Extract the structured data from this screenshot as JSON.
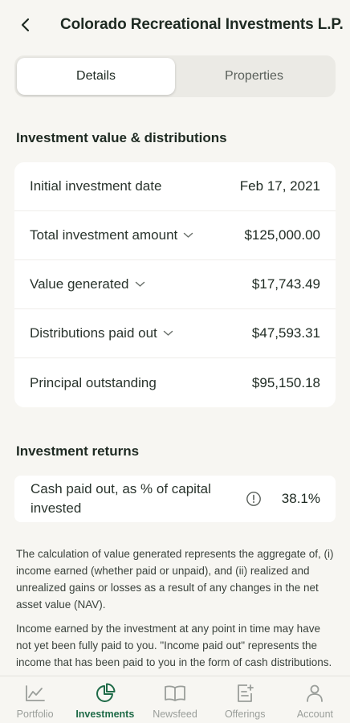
{
  "header": {
    "back_icon": "chevron-left-icon",
    "title": "Colorado Recreational Investments L.P."
  },
  "tabs": [
    {
      "label": "Details",
      "active": true
    },
    {
      "label": "Properties",
      "active": false
    }
  ],
  "value_section": {
    "title": "Investment value & distributions",
    "rows": [
      {
        "label": "Initial investment date",
        "value": "Feb 17, 2021",
        "expandable": false
      },
      {
        "label": "Total investment amount",
        "value": "$125,000.00",
        "expandable": true
      },
      {
        "label": "Value generated",
        "value": "$17,743.49",
        "expandable": true
      },
      {
        "label": "Distributions paid out",
        "value": "$47,593.31",
        "expandable": true
      },
      {
        "label": "Principal outstanding",
        "value": "$95,150.18",
        "expandable": false
      }
    ]
  },
  "returns_section": {
    "title": "Investment returns",
    "label": "Cash paid out, as % of capital invested",
    "info_icon": "info-icon",
    "value": "38.1%"
  },
  "notes": [
    "The calculation of value generated represents the aggregate of, (i) income earned (whether paid or unpaid), and (ii) realized and unrealized gains or losses as a result of any changes in the net asset value (NAV).",
    "Income earned by the investment at any point in time may have not yet been fully paid to you. \"Income paid out\" represents the income that has been paid to you in the form of cash distributions."
  ],
  "bottom_nav": [
    {
      "label": "Portfolio",
      "icon": "portfolio-chart-icon",
      "active": false
    },
    {
      "label": "Investments",
      "icon": "pie-chart-icon",
      "active": true
    },
    {
      "label": "Newsfeed",
      "icon": "book-icon",
      "active": false
    },
    {
      "label": "Offerings",
      "icon": "offerings-icon",
      "active": false
    },
    {
      "label": "Account",
      "icon": "person-icon",
      "active": false
    }
  ],
  "colors": {
    "accent": "#1f6b48",
    "background": "#f7f6f2",
    "card": "#ffffff",
    "inactive_nav": "#9a9e9a"
  }
}
